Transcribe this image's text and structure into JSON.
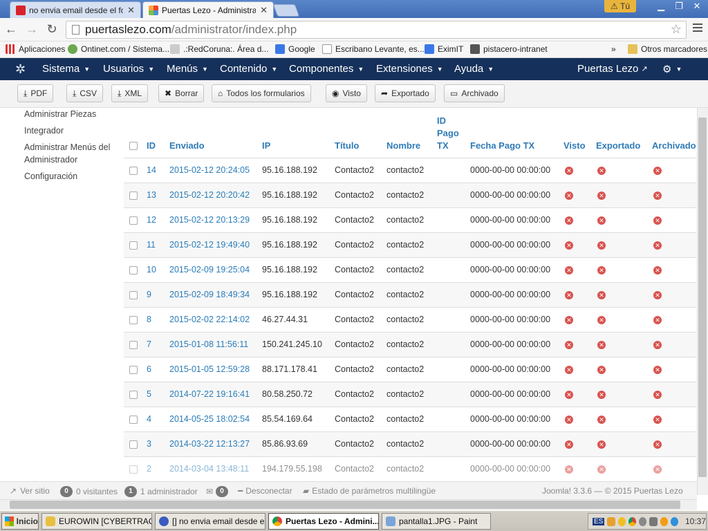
{
  "browser": {
    "tabs": [
      {
        "title": "no envia email desde el form",
        "active": false
      },
      {
        "title": "Puertas Lezo - Administració",
        "active": true
      }
    ],
    "user_badge": "Tú",
    "url_host": "puertaslezo.com",
    "url_path": "/administrator/index.php"
  },
  "bookmarks": {
    "items": [
      "Aplicaciones",
      "Ontinet.com / Sistema...",
      ".:RedCoruna:. Área d...",
      "Google",
      "Escribano Levante, es...",
      "EximIT",
      "pistacero-intranet"
    ],
    "overflow": "»",
    "other": "Otros marcadores"
  },
  "joomla_nav": {
    "menus": [
      "Sistema",
      "Usuarios",
      "Menús",
      "Contenido",
      "Componentes",
      "Extensiones",
      "Ayuda"
    ],
    "site_name": "Puertas Lezo"
  },
  "actions": [
    "PDF",
    "CSV",
    "XML",
    "Borrar",
    "Todos los formularios",
    "Visto",
    "Exportado",
    "Archivado"
  ],
  "sidebar": [
    "Administrar Piezas",
    "Integrador",
    "Administrar Menús del Administrador",
    "Configuración"
  ],
  "table": {
    "headers": {
      "id": "ID",
      "enviado": "Enviado",
      "ip": "IP",
      "titulo": "Título",
      "nombre": "Nombre",
      "idpago": "ID Pago TX",
      "fecha": "Fecha Pago TX",
      "visto": "Visto",
      "exportado": "Exportado",
      "archivado": "Archivado"
    },
    "rows": [
      {
        "id": "14",
        "enviado": "2015-02-12 20:24:05",
        "ip": "95.16.188.192",
        "titulo": "Contacto2",
        "nombre": "contacto2",
        "fecha": "0000-00-00 00:00:00"
      },
      {
        "id": "13",
        "enviado": "2015-02-12 20:20:42",
        "ip": "95.16.188.192",
        "titulo": "Contacto2",
        "nombre": "contacto2",
        "fecha": "0000-00-00 00:00:00"
      },
      {
        "id": "12",
        "enviado": "2015-02-12 20:13:29",
        "ip": "95.16.188.192",
        "titulo": "Contacto2",
        "nombre": "contacto2",
        "fecha": "0000-00-00 00:00:00"
      },
      {
        "id": "11",
        "enviado": "2015-02-12 19:49:40",
        "ip": "95.16.188.192",
        "titulo": "Contacto2",
        "nombre": "contacto2",
        "fecha": "0000-00-00 00:00:00"
      },
      {
        "id": "10",
        "enviado": "2015-02-09 19:25:04",
        "ip": "95.16.188.192",
        "titulo": "Contacto2",
        "nombre": "contacto2",
        "fecha": "0000-00-00 00:00:00"
      },
      {
        "id": "9",
        "enviado": "2015-02-09 18:49:34",
        "ip": "95.16.188.192",
        "titulo": "Contacto2",
        "nombre": "contacto2",
        "fecha": "0000-00-00 00:00:00"
      },
      {
        "id": "8",
        "enviado": "2015-02-02 22:14:02",
        "ip": "46.27.44.31",
        "titulo": "Contacto2",
        "nombre": "contacto2",
        "fecha": "0000-00-00 00:00:00"
      },
      {
        "id": "7",
        "enviado": "2015-01-08 11:56:11",
        "ip": "150.241.245.10",
        "titulo": "Contacto2",
        "nombre": "contacto2",
        "fecha": "0000-00-00 00:00:00"
      },
      {
        "id": "6",
        "enviado": "2015-01-05 12:59:28",
        "ip": "88.171.178.41",
        "titulo": "Contacto2",
        "nombre": "contacto2",
        "fecha": "0000-00-00 00:00:00"
      },
      {
        "id": "5",
        "enviado": "2014-07-22 19:16:41",
        "ip": "80.58.250.72",
        "titulo": "Contacto2",
        "nombre": "contacto2",
        "fecha": "0000-00-00 00:00:00"
      },
      {
        "id": "4",
        "enviado": "2014-05-25 18:02:54",
        "ip": "85.54.169.64",
        "titulo": "Contacto2",
        "nombre": "contacto2",
        "fecha": "0000-00-00 00:00:00"
      },
      {
        "id": "3",
        "enviado": "2014-03-22 12:13:27",
        "ip": "85.86.93.69",
        "titulo": "Contacto2",
        "nombre": "contacto2",
        "fecha": "0000-00-00 00:00:00"
      },
      {
        "id": "2",
        "enviado": "2014-03-04 13:48:11",
        "ip": "194.179.55.198",
        "titulo": "Contacto2",
        "nombre": "contacto2",
        "fecha": "0000-00-00 00:00:00"
      }
    ]
  },
  "footer": {
    "ver_sitio": "Ver sitio",
    "visitors_count": "0",
    "visitors_label": "0 visitantes",
    "admins_count": "1",
    "admins_label": "1 administrador",
    "messages_count": "0",
    "disconnect": "Desconectar",
    "multilang": "Estado de parámetros multilingüe",
    "version": "Joomla! 3.3.6 — © 2015 Puertas Lezo"
  },
  "taskbar": {
    "start": "Inicio",
    "items": [
      "EUROWIN [CYBERTRAC...",
      "[] no envia email desde e...",
      "Puertas Lezo - Admini...",
      "pantalla1.JPG - Paint"
    ],
    "lang": "ES",
    "clock": "10:37"
  }
}
